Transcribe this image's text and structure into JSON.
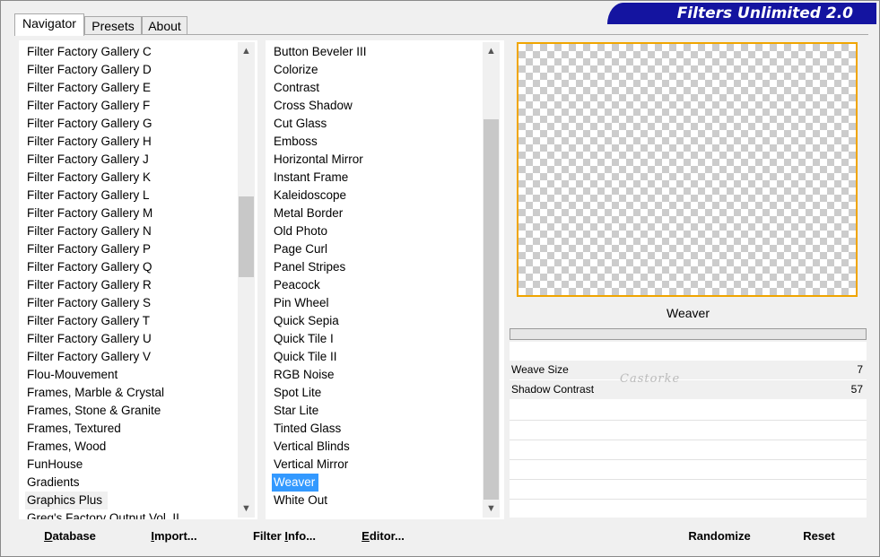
{
  "banner": {
    "title": "Filters Unlimited 2.0"
  },
  "tabs": [
    {
      "label": "Navigator",
      "active": true
    },
    {
      "label": "Presets",
      "active": false
    },
    {
      "label": "About",
      "active": false
    }
  ],
  "categories": [
    "Filter Factory Gallery C",
    "Filter Factory Gallery D",
    "Filter Factory Gallery E",
    "Filter Factory Gallery F",
    "Filter Factory Gallery G",
    "Filter Factory Gallery H",
    "Filter Factory Gallery J",
    "Filter Factory Gallery K",
    "Filter Factory Gallery L",
    "Filter Factory Gallery M",
    "Filter Factory Gallery N",
    "Filter Factory Gallery P",
    "Filter Factory Gallery Q",
    "Filter Factory Gallery R",
    "Filter Factory Gallery S",
    "Filter Factory Gallery T",
    "Filter Factory Gallery U",
    "Filter Factory Gallery V",
    "Flou-Mouvement",
    "Frames, Marble & Crystal",
    "Frames, Stone & Granite",
    "Frames, Textured",
    "Frames, Wood",
    "FunHouse",
    "Gradients",
    "Graphics Plus",
    "Greg's Factory Output Vol. II"
  ],
  "selected_category": "Graphics Plus",
  "filters": [
    "Button Beveler III",
    "Colorize",
    "Contrast",
    "Cross Shadow",
    "Cut Glass",
    "Emboss",
    "Horizontal Mirror",
    "Instant Frame",
    "Kaleidoscope",
    "Metal Border",
    "Old Photo",
    "Page Curl",
    "Panel Stripes",
    "Peacock",
    "Pin Wheel",
    "Quick Sepia",
    "Quick Tile I",
    "Quick Tile II",
    "RGB Noise",
    "Spot Lite",
    "Star Lite",
    "Tinted Glass",
    "Vertical Blinds",
    "Vertical Mirror",
    "Weaver",
    "White Out"
  ],
  "selected_filter": "Weaver",
  "preview": {
    "filter_name": "Weaver"
  },
  "params": [
    {
      "label": "Weave Size",
      "value": "7"
    },
    {
      "label": "Shadow Contrast",
      "value": "57"
    }
  ],
  "watermark": "Castorke",
  "buttons": {
    "database": {
      "label_u": "D",
      "label_rest": "atabase"
    },
    "import": {
      "label_u": "I",
      "label_rest": "mport..."
    },
    "filter_info": {
      "label_pre": "Filter ",
      "label_u": "I",
      "label_rest": "nfo..."
    },
    "editor": {
      "label_u": "E",
      "label_rest": "ditor..."
    },
    "randomize": {
      "label": "Randomize"
    },
    "reset": {
      "label": "Reset"
    }
  },
  "colors": {
    "accent_banner": "#1414a0",
    "selection": "#3399ff",
    "preview_border": "#f0a500"
  }
}
